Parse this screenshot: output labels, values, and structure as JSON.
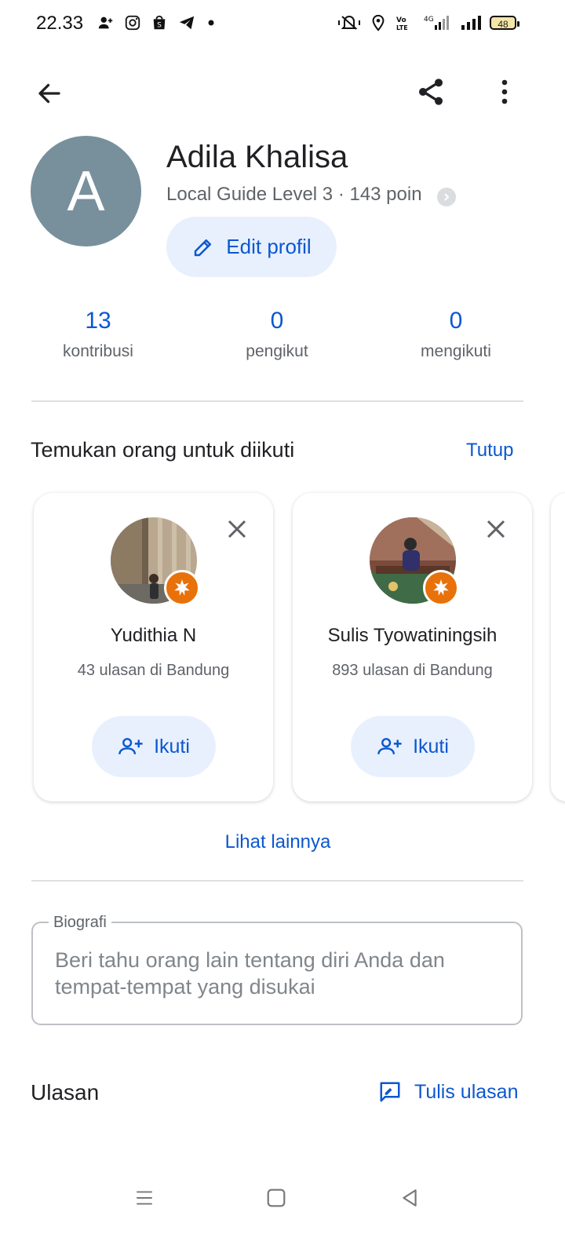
{
  "status_bar": {
    "time": "22.33",
    "battery": "48",
    "network": "4G"
  },
  "top_bar": {
    "back_icon": "arrow-back-icon",
    "share_icon": "share-icon",
    "more_icon": "more-vert-icon"
  },
  "profile": {
    "avatar_letter": "A",
    "avatar_color": "#78909c",
    "name": "Adila Khalisa",
    "guide_level": "Local Guide Level 3 · 143 poin",
    "edit_label": "Edit profil"
  },
  "stats": [
    {
      "value": "13",
      "label": "kontribusi"
    },
    {
      "value": "0",
      "label": "pengikut"
    },
    {
      "value": "0",
      "label": "mengikuti"
    }
  ],
  "suggestions": {
    "title": "Temukan orang untuk diikuti",
    "dismiss_label": "Tutup",
    "people": [
      {
        "name": "Yudithia N",
        "subtitle": "43 ulasan di Bandung",
        "follow_label": "Ikuti"
      },
      {
        "name": "Sulis Tyowatiningsih",
        "subtitle": "893 ulasan di Bandung",
        "follow_label": "Ikuti"
      }
    ],
    "see_more_label": "Lihat lainnya"
  },
  "bio": {
    "label": "Biografi",
    "placeholder": "Beri tahu orang lain tentang diri Anda dan tempat-tempat yang disukai"
  },
  "reviews": {
    "title": "Ulasan",
    "write_label": "Tulis ulasan"
  },
  "colors": {
    "accent": "#0b57d0",
    "tonal_button": "#e8f0fe",
    "badge": "#e8710a"
  }
}
